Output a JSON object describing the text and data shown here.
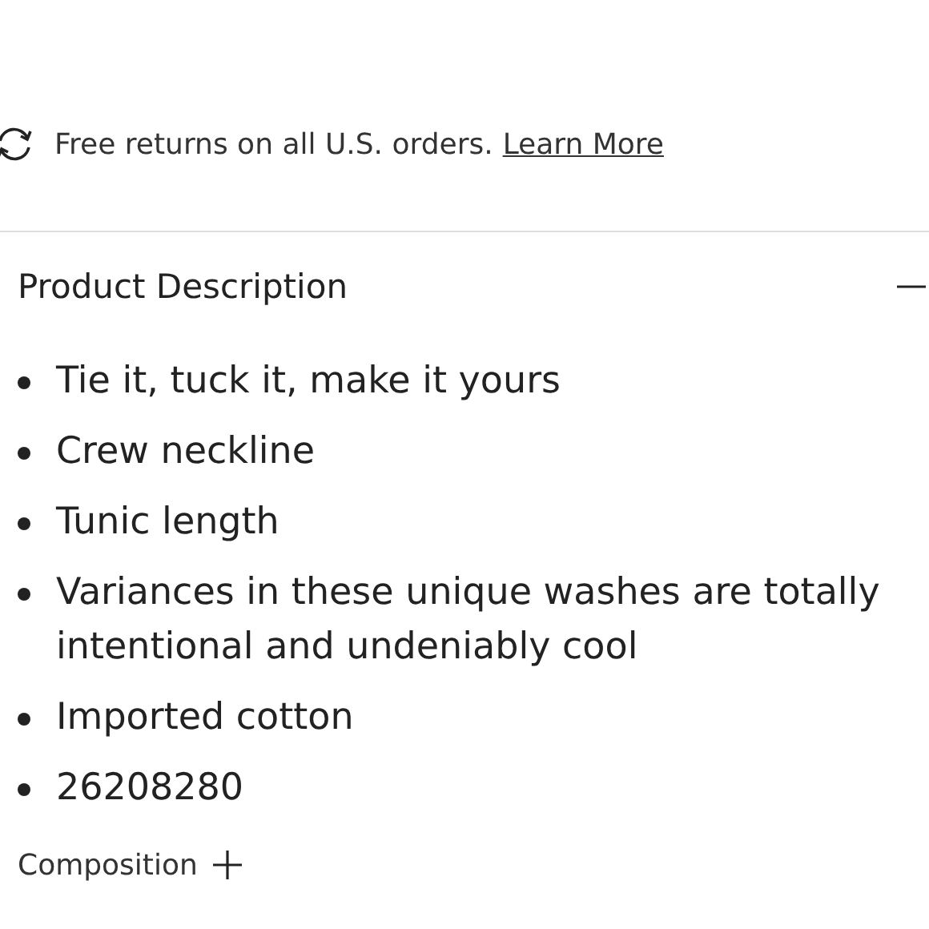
{
  "returns_banner": {
    "text": "Free returns on all U.S. orders.",
    "link": "Learn More"
  },
  "product_description": {
    "title": "Product Description",
    "expanded": true,
    "bullets": [
      "Tie it, tuck it, make it yours",
      "Crew neckline",
      "Tunic length",
      "Variances in these unique washes are totally intentional and undeniably cool",
      "Imported cotton",
      "26208280"
    ]
  },
  "composition": {
    "title": "Composition",
    "expanded": false
  }
}
